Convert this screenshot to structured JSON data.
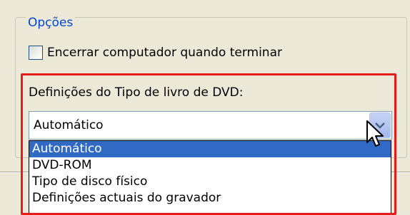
{
  "options_group": {
    "legend": "Opções",
    "shutdown_checkbox": {
      "label": "Encerrar computador quando terminar",
      "checked": false
    }
  },
  "booktype": {
    "label": "Definições do Tipo de livro de DVD:",
    "selected_value": "Automático",
    "dropdown_open": true,
    "options": [
      {
        "label": "Automático",
        "selected": true
      },
      {
        "label": "DVD-ROM",
        "selected": false
      },
      {
        "label": "Tipo de disco físico",
        "selected": false
      },
      {
        "label": "Definições actuais do gravador",
        "selected": false
      }
    ]
  },
  "colors": {
    "legend_text": "#0046d5",
    "highlight_border": "#e51c1c",
    "selection": "#316ac5"
  }
}
